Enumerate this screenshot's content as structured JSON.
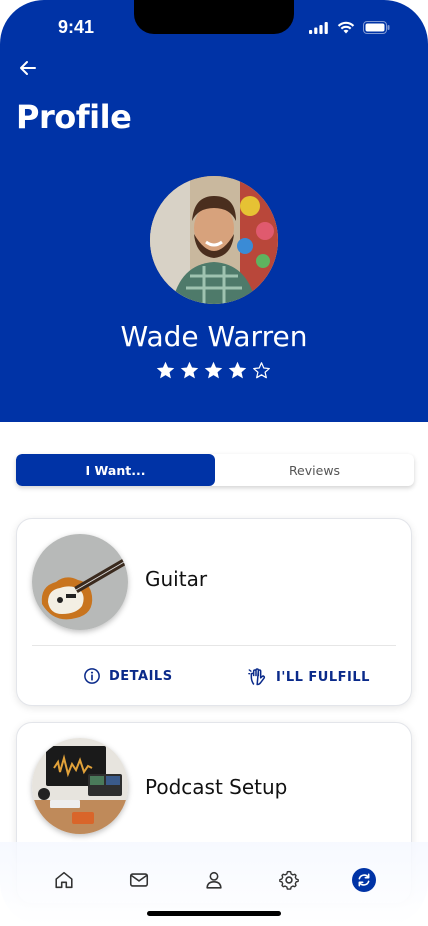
{
  "status_bar": {
    "time": "9:41"
  },
  "header": {
    "title": "Profile"
  },
  "profile": {
    "name": "Wade Warren",
    "rating": 4,
    "max_rating": 5
  },
  "tabs": [
    {
      "label": "I Want...",
      "active": true
    },
    {
      "label": "Reviews",
      "active": false
    }
  ],
  "wants": [
    {
      "title": "Guitar",
      "details_label": "DETAILS",
      "fulfill_label": "I'LL FULFILL"
    },
    {
      "title": "Podcast Setup"
    }
  ],
  "bottom_nav": [
    {
      "icon": "home-icon"
    },
    {
      "icon": "mail-icon"
    },
    {
      "icon": "user-icon"
    },
    {
      "icon": "gear-icon"
    },
    {
      "icon": "refresh-icon",
      "active": true
    }
  ],
  "colors": {
    "primary": "#0033a6",
    "action_text": "#0a2a8a"
  }
}
